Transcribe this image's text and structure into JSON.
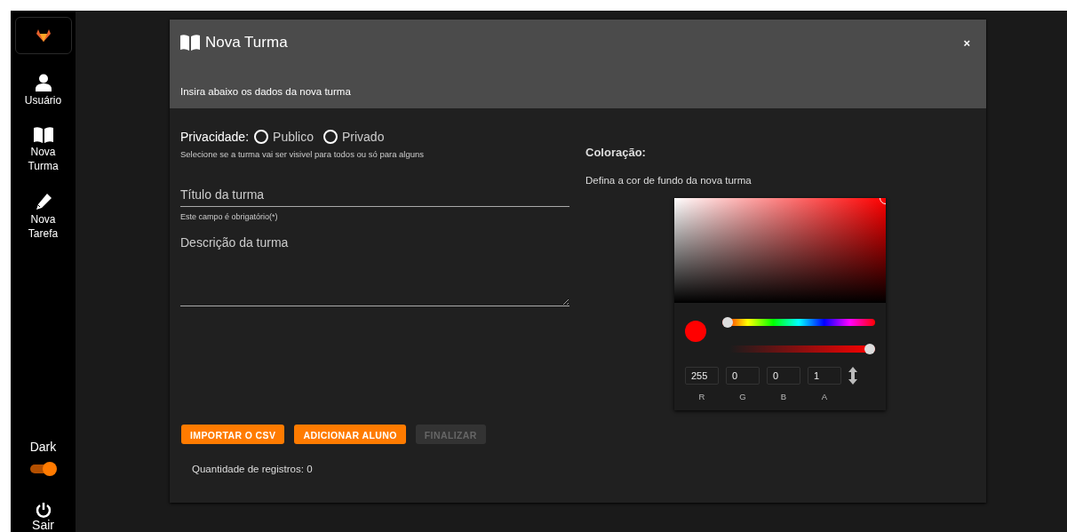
{
  "sidebar": {
    "items": [
      {
        "kind": "user",
        "label": "Usuário"
      },
      {
        "kind": "book",
        "label": "Nova Turma"
      },
      {
        "kind": "pencil",
        "label": "Nova Tarefa"
      }
    ],
    "theme": {
      "label": "Dark",
      "on": true
    },
    "logout": "Sair"
  },
  "dialog": {
    "title": "Nova Turma",
    "close": "×",
    "subtitle": "Insira abaixo os dados da nova turma",
    "privacy": {
      "label": "Privacidade:",
      "options": [
        {
          "label": "Publico",
          "selected": false
        },
        {
          "label": "Privado",
          "selected": false
        }
      ],
      "hint": "Selecione se a turma vai ser visivel para todos ou só para alguns"
    },
    "title_field": {
      "placeholder": "Título da turma",
      "helper": "Este campo é obrigatório(*)"
    },
    "description_field": {
      "placeholder": "Descrição da turma"
    },
    "buttons": [
      {
        "label": "IMPORTAR O CSV",
        "disabled": false
      },
      {
        "label": "ADICIONAR ALUNO",
        "disabled": false
      },
      {
        "label": "FINALIZAR",
        "disabled": true
      }
    ],
    "record_count": "Quantidade de registros: 0",
    "color": {
      "heading": "Coloração:",
      "hint": "Defina a cor de fundo da nova turma",
      "hue": {
        "level": 0
      },
      "alpha": {
        "level": 1
      },
      "channels": [
        {
          "value": "255",
          "label": "R"
        },
        {
          "value": "0",
          "label": "G"
        },
        {
          "value": "0",
          "label": "B"
        },
        {
          "value": "1",
          "label": "A"
        }
      ]
    }
  }
}
